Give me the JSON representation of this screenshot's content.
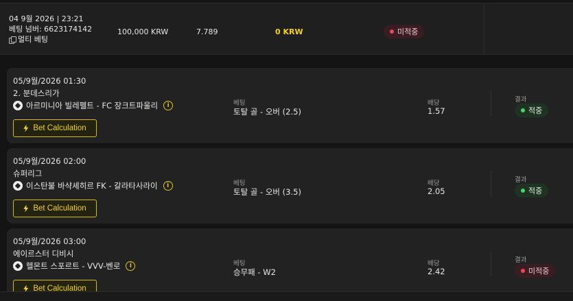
{
  "summary": {
    "datetime": "04 9월 2026 | 23:21",
    "bet_number": "베팅 넘버: 6623174142",
    "bet_type": "멀티 베팅",
    "stake": "100,000 KRW",
    "odds": "7.789",
    "winnings": "0 KRW",
    "status": "미적중",
    "status_color": "#e64a55",
    "winnings_color": "#f4d21c"
  },
  "labels": {
    "bet": "베팅",
    "odds": "배당",
    "result": "결과",
    "calc_button": "Bet Calculation"
  },
  "selections": [
    {
      "date": "05/9월/2026 01:30",
      "league": "2. 분데스리가",
      "match": "아르미니아 빌레펠트 - FC 장크트파울리",
      "bet": "토탈 골 - 오버 (2.5)",
      "odds": "1.57",
      "result": "적중",
      "result_state": "won"
    },
    {
      "date": "05/9월/2026 02:00",
      "league": "슈퍼리그",
      "match": "이스탄불 바샥셰히르 FK - 갈라타사라이",
      "bet": "토탈 골 - 오버 (3.5)",
      "odds": "2.05",
      "result": "적중",
      "result_state": "won"
    },
    {
      "date": "05/9월/2026 03:00",
      "league": "에이르스터 디비시",
      "match": "헬몬트 스포르트 - VVV-벤로",
      "bet": "승무패 - W2",
      "odds": "2.42",
      "result": "미적중",
      "result_state": "lost"
    }
  ],
  "icons": {
    "copy": "copy-icon",
    "sport": "soccer-ball-icon",
    "info": "info-icon",
    "calc": "lightning-bolt-icon"
  },
  "colors": {
    "accent": "#f0d226",
    "won": "#4bd36a",
    "lost": "#e64a55"
  }
}
